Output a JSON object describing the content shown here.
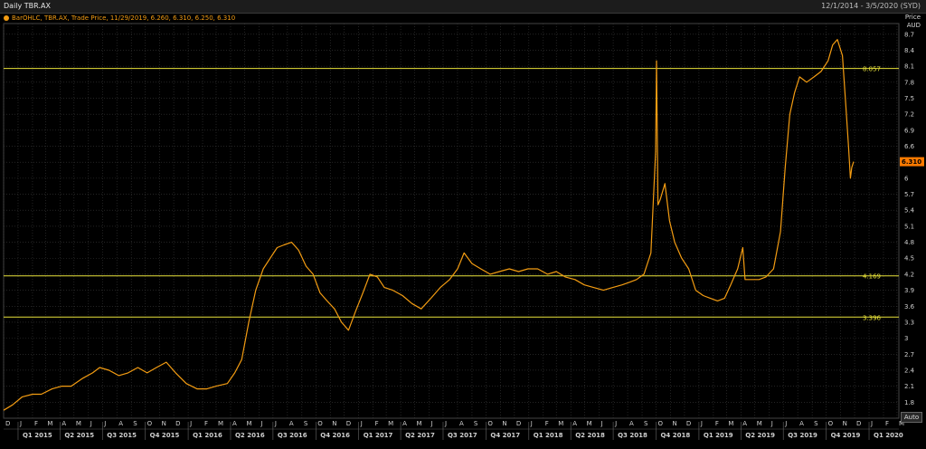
{
  "header": {
    "title": "Daily TBR.AX",
    "date_range": "12/1/2014 - 3/5/2020 (SYD)"
  },
  "legend": {
    "text": "BarOHLC, TBR.AX, Trade Price, 11/29/2019, 6.260, 6.310, 6.250, 6.310"
  },
  "axis": {
    "title_line1": "Price",
    "title_line2": "AUD"
  },
  "controls": {
    "auto_label": "Auto"
  },
  "colors": {
    "price": "#f39c12",
    "hline": "#e8e23a",
    "last_tag": "#ff7a00",
    "grid": "#3a3a3a"
  },
  "chart_data": {
    "type": "line",
    "title": "Daily TBR.AX",
    "xlabel": "",
    "ylabel": "Price AUD",
    "ylim": [
      1.5,
      8.9
    ],
    "yticks": [
      1.8,
      2.1,
      2.4,
      2.7,
      3,
      3.3,
      3.6,
      3.9,
      4.2,
      4.5,
      4.8,
      5.1,
      5.4,
      5.7,
      6,
      6.3,
      6.6,
      6.9,
      7.2,
      7.5,
      7.8,
      8.1,
      8.4,
      8.7
    ],
    "month_ticks": [
      "D",
      "J",
      "F",
      "M",
      "A",
      "M",
      "J",
      "J",
      "A",
      "S",
      "O",
      "N",
      "D",
      "J",
      "F",
      "M",
      "A",
      "M",
      "J",
      "J",
      "A",
      "S",
      "O",
      "N",
      "D",
      "J",
      "F",
      "M",
      "A",
      "M",
      "J",
      "J",
      "A",
      "S",
      "O",
      "N",
      "D",
      "J",
      "F",
      "M",
      "A",
      "M",
      "J",
      "J",
      "A",
      "S",
      "O",
      "N",
      "D",
      "J",
      "F",
      "M",
      "A",
      "M",
      "J",
      "J",
      "A",
      "S",
      "O",
      "N",
      "D",
      "J",
      "F",
      "M"
    ],
    "quarter_labels": [
      "Q1 2015",
      "Q2 2015",
      "Q3 2015",
      "Q4 2015",
      "Q1 2016",
      "Q2 2016",
      "Q3 2016",
      "Q4 2016",
      "Q1 2017",
      "Q2 2017",
      "Q3 2017",
      "Q4 2017",
      "Q1 2018",
      "Q2 2018",
      "Q3 2018",
      "Q4 2018",
      "Q1 2019",
      "Q2 2019",
      "Q3 2019",
      "Q4 2019",
      "Q1 2020"
    ],
    "horizontal_lines": [
      {
        "value": 8.057,
        "label": "8.057"
      },
      {
        "value": 4.169,
        "label": "4.169"
      },
      {
        "value": 3.396,
        "label": "3.396"
      }
    ],
    "last_value": {
      "value": 6.31,
      "label": "6.310"
    },
    "series": [
      {
        "dates": [
          "2014-12-01",
          "2014-12-20",
          "2015-01-10",
          "2015-02-01",
          "2015-02-20",
          "2015-03-15",
          "2015-04-05",
          "2015-04-25",
          "2015-05-20",
          "2015-06-10",
          "2015-06-25",
          "2015-07-15",
          "2015-08-05",
          "2015-08-25",
          "2015-09-15",
          "2015-10-05",
          "2015-10-25",
          "2015-11-15",
          "2015-12-05",
          "2015-12-28",
          "2016-01-20",
          "2016-02-10",
          "2016-03-01",
          "2016-03-25",
          "2016-04-10",
          "2016-04-25",
          "2016-05-10",
          "2016-05-25",
          "2016-06-10",
          "2016-06-25",
          "2016-07-10",
          "2016-07-25",
          "2016-08-10",
          "2016-08-25",
          "2016-09-10",
          "2016-09-25",
          "2016-10-10",
          "2016-10-25",
          "2016-11-10",
          "2016-11-25",
          "2016-12-10",
          "2016-12-25",
          "2017-01-10",
          "2017-01-25",
          "2017-02-10",
          "2017-02-25",
          "2017-03-15",
          "2017-04-05",
          "2017-04-25",
          "2017-05-15",
          "2017-06-05",
          "2017-06-25",
          "2017-07-15",
          "2017-08-01",
          "2017-08-15",
          "2017-09-01",
          "2017-09-20",
          "2017-10-10",
          "2017-10-30",
          "2017-11-20",
          "2017-12-10",
          "2017-12-30",
          "2018-01-20",
          "2018-02-10",
          "2018-03-01",
          "2018-03-20",
          "2018-04-10",
          "2018-04-30",
          "2018-05-20",
          "2018-06-10",
          "2018-06-30",
          "2018-07-20",
          "2018-08-05",
          "2018-08-20",
          "2018-09-05",
          "2018-09-20",
          "2018-09-30",
          "2018-10-02",
          "2018-10-05",
          "2018-10-10",
          "2018-10-20",
          "2018-10-30",
          "2018-11-10",
          "2018-11-25",
          "2018-12-10",
          "2018-12-25",
          "2019-01-10",
          "2019-01-25",
          "2019-02-10",
          "2019-02-25",
          "2019-03-10",
          "2019-03-25",
          "2019-04-05",
          "2019-04-10",
          "2019-04-25",
          "2019-05-10",
          "2019-05-25",
          "2019-06-10",
          "2019-06-25",
          "2019-07-05",
          "2019-07-15",
          "2019-07-25",
          "2019-08-05",
          "2019-08-20",
          "2019-09-05",
          "2019-09-20",
          "2019-10-05",
          "2019-10-15",
          "2019-10-25",
          "2019-11-05",
          "2019-11-12",
          "2019-11-18",
          "2019-11-22",
          "2019-11-25",
          "2019-11-29"
        ],
        "values": [
          1.65,
          1.75,
          1.9,
          1.95,
          1.95,
          2.05,
          2.1,
          2.1,
          2.25,
          2.35,
          2.45,
          2.4,
          2.3,
          2.35,
          2.45,
          2.35,
          2.45,
          2.55,
          2.35,
          2.15,
          2.05,
          2.05,
          2.1,
          2.15,
          2.35,
          2.6,
          3.3,
          3.9,
          4.3,
          4.5,
          4.7,
          4.75,
          4.8,
          4.65,
          4.35,
          4.2,
          3.85,
          3.7,
          3.55,
          3.3,
          3.15,
          3.5,
          3.85,
          4.2,
          4.15,
          3.95,
          3.9,
          3.8,
          3.65,
          3.55,
          3.75,
          3.95,
          4.1,
          4.3,
          4.6,
          4.4,
          4.3,
          4.2,
          4.25,
          4.3,
          4.25,
          4.3,
          4.3,
          4.2,
          4.25,
          4.15,
          4.1,
          4.0,
          3.95,
          3.9,
          3.95,
          4.0,
          4.05,
          4.1,
          4.2,
          4.6,
          6.5,
          8.2,
          5.5,
          5.6,
          5.9,
          5.2,
          4.8,
          4.5,
          4.3,
          3.9,
          3.8,
          3.75,
          3.7,
          3.75,
          4.0,
          4.3,
          4.7,
          4.1,
          4.1,
          4.1,
          4.15,
          4.3,
          5.0,
          6.2,
          7.2,
          7.6,
          7.9,
          7.8,
          7.9,
          8.0,
          8.2,
          8.5,
          8.6,
          8.3,
          7.4,
          6.6,
          6.0,
          6.2,
          6.31
        ]
      }
    ]
  }
}
